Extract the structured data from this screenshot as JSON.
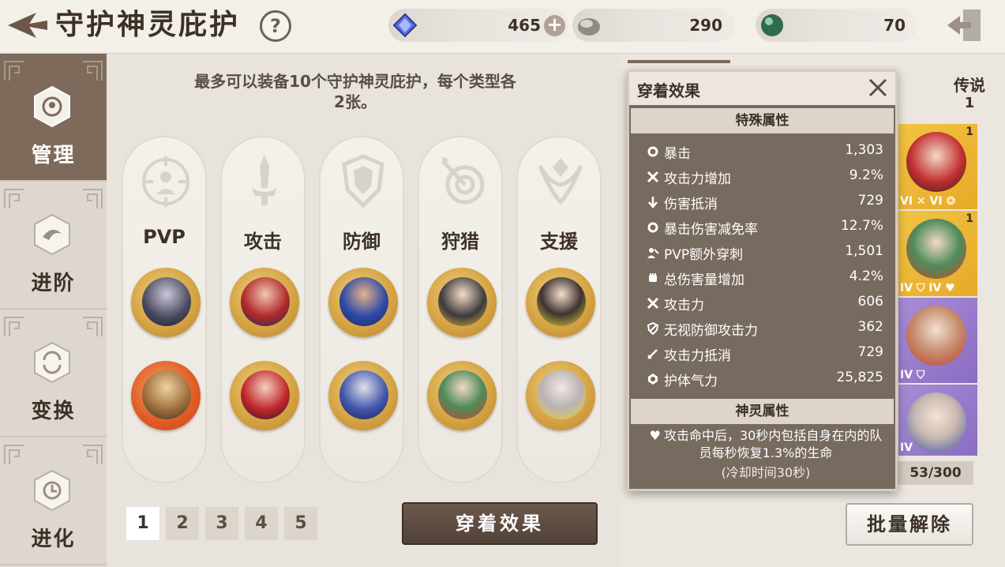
{
  "header": {
    "title": "守护神灵庇护",
    "help_icon": "?",
    "currencies": [
      {
        "name": "gem-icon",
        "amount": "465",
        "plus": "+"
      },
      {
        "name": "stone-icon",
        "amount": "290"
      },
      {
        "name": "green-orb-icon",
        "amount": "70"
      }
    ]
  },
  "nav": {
    "items": [
      {
        "label": "管理",
        "icon": "manage-icon",
        "active": true
      },
      {
        "label": "进阶",
        "icon": "advance-icon"
      },
      {
        "label": "变换",
        "icon": "transform-icon"
      },
      {
        "label": "进化",
        "icon": "evolve-icon"
      }
    ]
  },
  "main": {
    "info": "最多可以装备10个守护神灵庇护，每个类型各2张。",
    "categories": [
      {
        "label": "PVP",
        "icon": "pvp-target-icon"
      },
      {
        "label": "攻击",
        "icon": "sword-icon"
      },
      {
        "label": "防御",
        "icon": "shield-icon"
      },
      {
        "label": "狩猎",
        "icon": "bullseye-icon"
      },
      {
        "label": "支援",
        "icon": "support-icon"
      }
    ],
    "pages": [
      "1",
      "2",
      "3",
      "4",
      "5"
    ],
    "effect_button": "穿着效果"
  },
  "right": {
    "legend_label": "传说",
    "legend_count": "1",
    "cards": [
      {
        "count": "1",
        "color": "gold",
        "marks": "VI ✕ VI ❂"
      },
      {
        "count": "1",
        "color": "gold",
        "marks": "IV ⛉ IV ♥"
      },
      {
        "count": "",
        "color": "purple",
        "marks": "IV ⛉"
      },
      {
        "count": "",
        "color": "purple",
        "marks": "IV"
      }
    ],
    "capacity": "53/300",
    "bulk_button": "批量解除"
  },
  "popup": {
    "title": "穿着效果",
    "special_header": "特殊属性",
    "stats": [
      {
        "icon": "gear-icon",
        "name": "暴击",
        "value": "1,303"
      },
      {
        "icon": "crossed-swords-icon",
        "name": "攻击力增加",
        "value": "9.2%"
      },
      {
        "icon": "down-arrow-icon",
        "name": "伤害抵消",
        "value": "729"
      },
      {
        "icon": "gear-icon",
        "name": "暴击伤害减免率",
        "value": "12.7%"
      },
      {
        "icon": "pvp-icon",
        "name": "PVP额外穿刺",
        "value": "1,501"
      },
      {
        "icon": "fist-icon",
        "name": "总伤害量增加",
        "value": "4.2%"
      },
      {
        "icon": "crossed-swords-icon",
        "name": "攻击力",
        "value": "606"
      },
      {
        "icon": "shield-icon",
        "name": "无视防御攻击力",
        "value": "362"
      },
      {
        "icon": "sword-icon",
        "name": "攻击力抵消",
        "value": "729"
      },
      {
        "icon": "aura-icon",
        "name": "护体气力",
        "value": "25,825"
      }
    ],
    "spirit_header": "神灵属性",
    "spirit_desc": "攻击命中后，30秒内包括自身在内的队员每秒恢复1.3%的生命",
    "spirit_note": "(冷却时间30秒)"
  },
  "colors": {
    "accent_brown": "#7d6a5b",
    "gold": "#e7a928",
    "purple": "#8a6cc3",
    "popup_bg": "#706256"
  }
}
